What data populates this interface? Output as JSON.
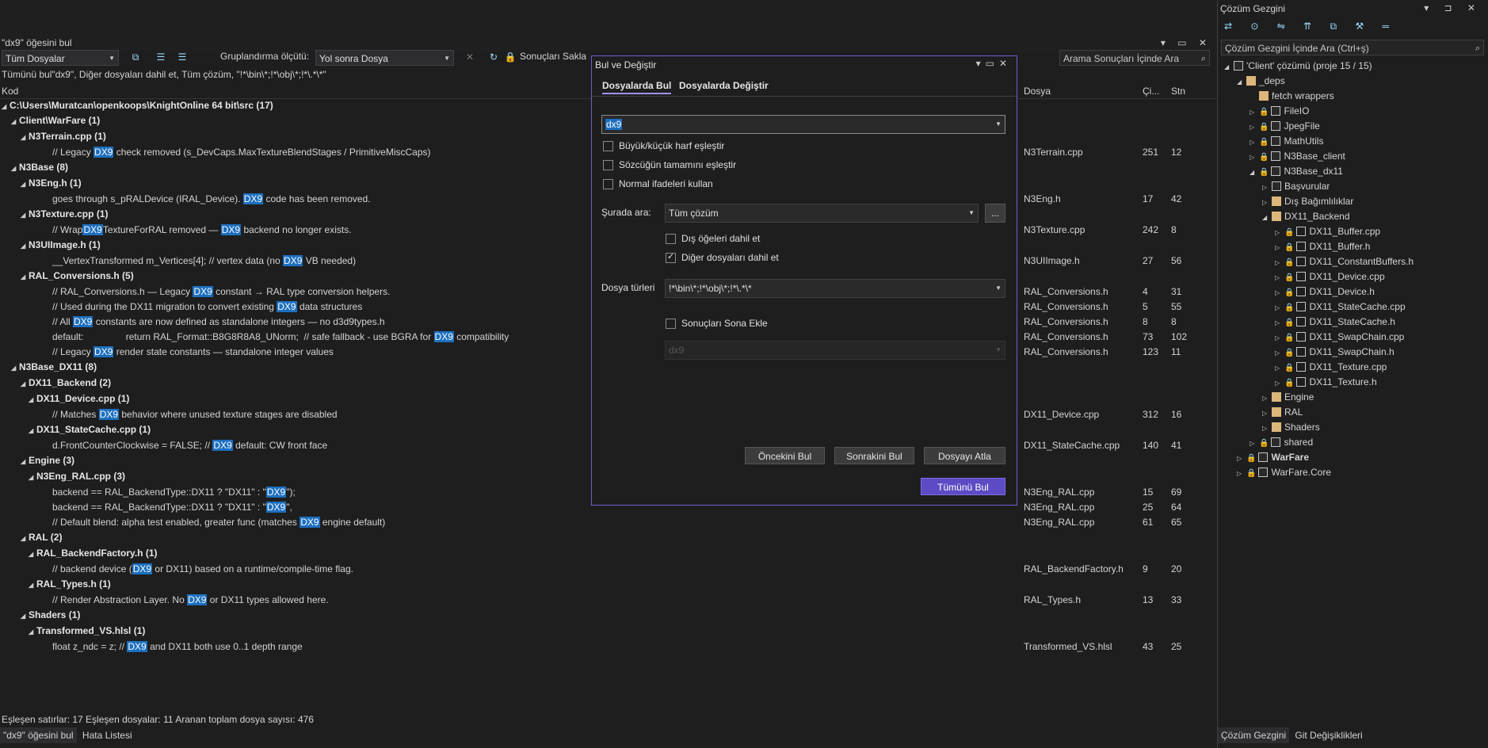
{
  "results": {
    "title": "\"dx9\" öğesini bul",
    "scope_combo": "Tüm Dosyalar",
    "group_label": "Gruplandırma ölçütü:",
    "group_combo": "Yol sonra Dosya",
    "keep_results": "Sonuçları Sakla",
    "search_in_results_placeholder": "Arama Sonuçları İçinde Ara",
    "summary": "Tümünü bul\"dx9\", Diğer dosyaları dahil et, Tüm çözüm, \"!*\\bin\\*;!*\\obj\\*;!*\\.*\\*\"",
    "col_code": "Kod",
    "col_file": "Dosya",
    "col_line": "Çi...",
    "col_col": "Stn",
    "root": "C:\\Users\\Muratcan\\openkoops\\KnightOnline 64 bit\\src",
    "root_count": "(17)",
    "g_client": "Client\\WarFare",
    "g_client_count": "(1)",
    "f_n3terrain": "N3Terrain.cpp",
    "f_n3terrain_count": "(1)",
    "r1_a": "// Legacy ",
    "r1_b": "DX9",
    "r1_c": " check removed (s_DevCaps.MaxTextureBlendStages / PrimitiveMiscCaps)",
    "r1_file": "N3Terrain.cpp",
    "r1_line": "251",
    "r1_col": "12",
    "g_n3base": "N3Base",
    "g_n3base_count": "(8)",
    "f_n3eng": "N3Eng.h",
    "f_n3eng_count": "(1)",
    "r2_a": "goes through s_pRALDevice (IRAL_Device). ",
    "r2_b": "DX9",
    "r2_c": " code has been removed.",
    "r2_file": "N3Eng.h",
    "r2_line": "17",
    "r2_col": "42",
    "f_n3texture": "N3Texture.cpp",
    "f_n3texture_count": "(1)",
    "r3_a": "// Wrap",
    "r3_b": "DX9",
    "r3_c": "TextureForRAL removed — ",
    "r3_d": "DX9",
    "r3_e": " backend no longer exists.",
    "r3_file": "N3Texture.cpp",
    "r3_line": "242",
    "r3_col": "8",
    "f_n3uiimage": "N3UIImage.h",
    "f_n3uiimage_count": "(1)",
    "r4_a": "__VertexTransformed m_Vertices[4]; // vertex data (no ",
    "r4_b": "DX9",
    "r4_c": " VB needed)",
    "r4_file": "N3UIImage.h",
    "r4_line": "27",
    "r4_col": "56",
    "f_ralconv": "RAL_Conversions.h",
    "f_ralconv_count": "(5)",
    "r5_a": "// RAL_Conversions.h — Legacy ",
    "r5_b": "DX9",
    "r5_c": " constant → RAL type conversion helpers.",
    "r5_file": "RAL_Conversions.h",
    "r5_line": "4",
    "r5_col": "31",
    "r6_a": "// Used during the DX11 migration to convert existing ",
    "r6_b": "DX9",
    "r6_c": " data structures",
    "r6_file": "RAL_Conversions.h",
    "r6_line": "5",
    "r6_col": "55",
    "r7_a": "// All ",
    "r7_b": "DX9",
    "r7_c": " constants are now defined as standalone integers — no d3d9types.h",
    "r7_file": "RAL_Conversions.h",
    "r7_line": "8",
    "r7_col": "8",
    "r8_a": "default:                return RAL_Format::B8G8R8A8_UNorm;  // safe fallback - use BGRA for ",
    "r8_b": "DX9",
    "r8_c": " compatibility",
    "r8_file": "RAL_Conversions.h",
    "r8_line": "73",
    "r8_col": "102",
    "r9_a": "// Legacy ",
    "r9_b": "DX9",
    "r9_c": " render state constants — standalone integer values",
    "r9_file": "RAL_Conversions.h",
    "r9_line": "123",
    "r9_col": "11",
    "g_n3basedx11": "N3Base_DX11",
    "g_n3basedx11_count": "(8)",
    "g_dx11backend": "DX11_Backend",
    "g_dx11backend_count": "(2)",
    "f_dx11device": "DX11_Device.cpp",
    "f_dx11device_count": "(1)",
    "r10_a": "// Matches ",
    "r10_b": "DX9",
    "r10_c": " behavior where unused texture stages are disabled",
    "r10_file": "DX11_Device.cpp",
    "r10_line": "312",
    "r10_col": "16",
    "f_dx11state": "DX11_StateCache.cpp",
    "f_dx11state_count": "(1)",
    "r11_a": "d.FrontCounterClockwise = FALSE; // ",
    "r11_b": "DX9",
    "r11_c": " default: CW front face",
    "r11_file": "DX11_StateCache.cpp",
    "r11_line": "140",
    "r11_col": "41",
    "g_engine": "Engine",
    "g_engine_count": "(3)",
    "f_n3engral": "N3Eng_RAL.cpp",
    "f_n3engral_count": "(3)",
    "r12_a": "backend == RAL_BackendType::DX11 ? \"DX11\" : \"",
    "r12_b": "DX9",
    "r12_c": "\");",
    "r12_file": "N3Eng_RAL.cpp",
    "r12_line": "15",
    "r12_col": "69",
    "r13_a": "backend == RAL_BackendType::DX11 ? \"DX11\" : \"",
    "r13_b": "DX9",
    "r13_c": "\",",
    "r13_file": "N3Eng_RAL.cpp",
    "r13_line": "25",
    "r13_col": "64",
    "r14_a": "// Default blend: alpha test enabled, greater func (matches ",
    "r14_b": "DX9",
    "r14_c": " engine default)",
    "r14_file": "N3Eng_RAL.cpp",
    "r14_line": "61",
    "r14_col": "65",
    "g_ral": "RAL",
    "g_ral_count": "(2)",
    "f_ralbf": "RAL_BackendFactory.h",
    "f_ralbf_count": "(1)",
    "r15_a": "// backend device (",
    "r15_b": "DX9",
    "r15_c": " or DX11) based on a runtime/compile-time flag.",
    "r15_file": "RAL_BackendFactory.h",
    "r15_line": "9",
    "r15_col": "20",
    "f_raltypes": "RAL_Types.h",
    "f_raltypes_count": "(1)",
    "r16_a": "// Render Abstraction Layer. No ",
    "r16_b": "DX9",
    "r16_c": " or DX11 types allowed here.",
    "r16_file": "RAL_Types.h",
    "r16_line": "13",
    "r16_col": "33",
    "g_shaders": "Shaders",
    "g_shaders_count": "(1)",
    "f_tvs": "Transformed_VS.hlsl",
    "f_tvs_count": "(1)",
    "r17_a": "float z_ndc = z; // ",
    "r17_b": "DX9",
    "r17_c": " and DX11 both use 0..1 depth range",
    "r17_file": "Transformed_VS.hlsl",
    "r17_line": "43",
    "r17_col": "25",
    "status": "Eşleşen satırlar: 17 Eşleşen dosyalar: 11 Aranan toplam dosya sayısı: 476",
    "tab_find": "\"dx9\" öğesini bul",
    "tab_errors": "Hata Listesi"
  },
  "dialog": {
    "title": "Bul ve Değiştir",
    "tab_find": "Dosyalarda Bul",
    "tab_replace": "Dosyalarda Değiştir",
    "search_value": "dx9",
    "opt_case": "Büyük/küçük harf eşleştir",
    "opt_word": "Sözcüğün tamamını eşleştir",
    "opt_regex": "Normal ifadeleri kullan",
    "look_in_label": "Şurada ara:",
    "look_in_value": "Tüm çözüm",
    "browse": "...",
    "opt_external": "Dış öğeleri dahil et",
    "opt_misc": "Diğer dosyaları dahil et",
    "filetypes_label": "Dosya türleri",
    "filetypes_value": "!*\\bin\\*;!*\\obj\\*;!*\\.*\\*",
    "opt_append": "Sonuçları Sona Ekle",
    "disabled_value": "dx9",
    "btn_prev": "Öncekini Bul",
    "btn_next": "Sonrakini Bul",
    "btn_skip": "Dosyayı Atla",
    "btn_all": "Tümünü Bul"
  },
  "solution": {
    "title": "Çözüm Gezgini",
    "search_placeholder": "Çözüm Gezgini İçinde Ara (Ctrl+ş)",
    "root": "'Client' çözümü (proje 15 / 15)",
    "items": [
      "_deps",
      "fetch wrappers",
      "FileIO",
      "JpegFile",
      "MathUtils",
      "N3Base_client",
      "N3Base_dx11",
      "Başvurular",
      "Dış Bağımlılıklar",
      "DX11_Backend",
      "DX11_Buffer.cpp",
      "DX11_Buffer.h",
      "DX11_ConstantBuffers.h",
      "DX11_Device.cpp",
      "DX11_Device.h",
      "DX11_StateCache.cpp",
      "DX11_StateCache.h",
      "DX11_SwapChain.cpp",
      "DX11_SwapChain.h",
      "DX11_Texture.cpp",
      "DX11_Texture.h",
      "Engine",
      "RAL",
      "Shaders",
      "shared",
      "WarFare",
      "WarFare.Core"
    ],
    "tab_sol": "Çözüm Gezgini",
    "tab_git": "Git Değişiklikleri"
  },
  "colors": {
    "accent": "#6b5fd0",
    "highlight": "#1c6fbf",
    "primary_btn": "#5b4bc4"
  }
}
